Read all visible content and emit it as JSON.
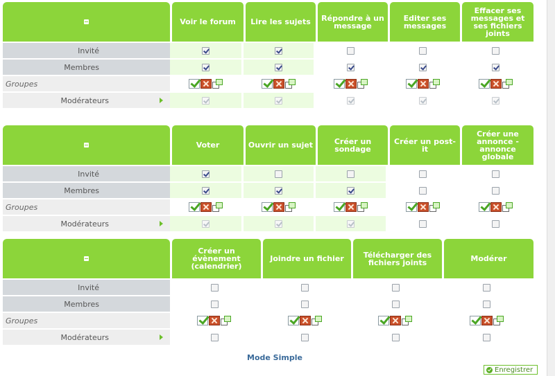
{
  "tables": [
    {
      "cols": [
        {
          "label": "Voir le forum",
          "w": 103
        },
        {
          "label": "Lire les sujets",
          "w": 101
        },
        {
          "label": "Répondre à un message",
          "w": 101
        },
        {
          "label": "Editer ses messages",
          "w": 101
        },
        {
          "label": "Effacer ses messages et ses fichiers joints",
          "w": 103
        }
      ],
      "rows": {
        "invite": {
          "label": "Invité",
          "cells": [
            1,
            1,
            0,
            0,
            0
          ]
        },
        "membres": {
          "label": "Membres",
          "cells": [
            1,
            1,
            1,
            1,
            1
          ]
        },
        "groupes": {
          "label": "Groupes"
        },
        "moderateurs": {
          "label": "Modérateurs",
          "cells": [
            1,
            1,
            1,
            1,
            1
          ]
        }
      },
      "green": [
        1,
        1,
        0,
        0,
        0
      ]
    },
    {
      "cols": [
        {
          "label": "Voter",
          "w": 103
        },
        {
          "label": "Ouvrir un sujet",
          "w": 101
        },
        {
          "label": "Créer un sondage",
          "w": 101
        },
        {
          "label": "Créer un post-it",
          "w": 101
        },
        {
          "label": "Créer une annonce - annonce globale",
          "w": 103
        }
      ],
      "rows": {
        "invite": {
          "label": "Invité",
          "cells": [
            1,
            0,
            0,
            0,
            0
          ]
        },
        "membres": {
          "label": "Membres",
          "cells": [
            1,
            1,
            1,
            0,
            0
          ]
        },
        "groupes": {
          "label": "Groupes"
        },
        "moderateurs": {
          "label": "Modérateurs",
          "cells": [
            1,
            1,
            1,
            0,
            0
          ]
        }
      },
      "green": [
        1,
        1,
        1,
        0,
        0
      ]
    },
    {
      "cols": [
        {
          "label": "Créer un évènement (calendrier)",
          "w": 128
        },
        {
          "label": "Joindre un fichier",
          "w": 127
        },
        {
          "label": "Télécharger des fichiers joints",
          "w": 128
        },
        {
          "label": "Modérer",
          "w": 129
        }
      ],
      "rows": {
        "invite": {
          "label": "Invité",
          "cells": [
            0,
            0,
            0,
            0
          ]
        },
        "membres": {
          "label": "Membres",
          "cells": [
            0,
            0,
            0,
            0
          ]
        },
        "groupes": {
          "label": "Groupes"
        },
        "moderateurs": {
          "label": "Modérateurs",
          "cells": [
            0,
            0,
            0,
            0
          ]
        }
      },
      "green": [
        0,
        0,
        0,
        0
      ]
    }
  ],
  "footer": {
    "mode_link": "Mode Simple",
    "save_label": "Enregistrer"
  }
}
